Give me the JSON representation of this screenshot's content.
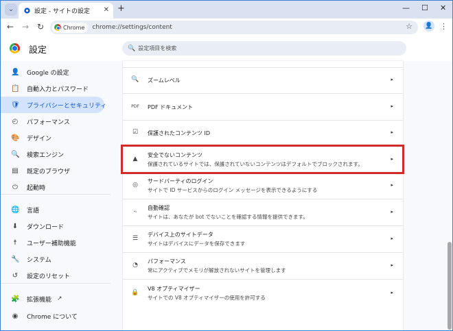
{
  "window": {
    "tab_title": "設定 - サイトの設定",
    "close_tab_glyph": "✕",
    "new_tab_glyph": "+",
    "minimize_glyph": "—",
    "maximize_glyph": "☐",
    "close_glyph": "✕"
  },
  "toolbar": {
    "chip_label": "Chrome",
    "url": "chrome://settings/content"
  },
  "header": {
    "title": "設定",
    "search_placeholder": "設定項目を検索"
  },
  "sidebar": {
    "items": [
      {
        "icon": "person-icon",
        "glyph": "👤",
        "label": "Google の設定"
      },
      {
        "icon": "clipboard-icon",
        "glyph": "📋",
        "label": "自動入力とパスワード"
      },
      {
        "icon": "shield-icon",
        "glyph": "🛡",
        "label": "プライバシーとセキュリティ"
      },
      {
        "icon": "gauge-icon",
        "glyph": "◴",
        "label": "パフォーマンス"
      },
      {
        "icon": "palette-icon",
        "glyph": "🎨",
        "label": "デザイン"
      },
      {
        "icon": "search-icon",
        "glyph": "🔍",
        "label": "検索エンジン"
      },
      {
        "icon": "browser-icon",
        "glyph": "▤",
        "label": "既定のブラウザ"
      },
      {
        "icon": "power-icon",
        "glyph": "⏻",
        "label": "起動時"
      },
      {
        "icon": "globe-icon",
        "glyph": "🌐",
        "label": "言語"
      },
      {
        "icon": "download-icon",
        "glyph": "⬇",
        "label": "ダウンロード"
      },
      {
        "icon": "accessibility-icon",
        "glyph": "☨",
        "label": "ユーザー補助機能"
      },
      {
        "icon": "wrench-icon",
        "glyph": "🔧",
        "label": "システム"
      },
      {
        "icon": "history-icon",
        "glyph": "↺",
        "label": "設定のリセット"
      },
      {
        "icon": "puzzle-icon",
        "glyph": "🧩",
        "label": "拡張機能"
      },
      {
        "icon": "chrome-icon",
        "glyph": "◉",
        "label": "Chrome について"
      }
    ],
    "active_index": 2
  },
  "content": {
    "rows": [
      {
        "icon": "magnifier-icon",
        "glyph": "🔍",
        "title": "ズームレベル",
        "sub": ""
      },
      {
        "icon": "pdf-icon",
        "glyph": "PDF",
        "title": "PDF ドキュメント",
        "sub": ""
      },
      {
        "icon": "protected-content-icon",
        "glyph": "☑",
        "title": "保護されたコンテンツ ID",
        "sub": ""
      },
      {
        "icon": "warning-icon",
        "glyph": "▲",
        "title": "安全でないコンテンツ",
        "sub": "保護されているサイトでは、保護されていないコンテンツはデフォルトでブロックされます。"
      },
      {
        "icon": "third-party-signin-icon",
        "glyph": "◎",
        "title": "サードパーティのログイン",
        "sub": "サイトで ID サービスからのログイン メッセージを表示できるようにする"
      },
      {
        "icon": "auto-verify-icon",
        "glyph": "⍨",
        "title": "自動確認",
        "sub": "サイトは、あなたが bot でないことを確認する情報を提供できます。"
      },
      {
        "icon": "database-icon",
        "glyph": "☰",
        "title": "デバイス上のサイトデータ",
        "sub": "サイトはデバイスにデータを保存できます"
      },
      {
        "icon": "performance-icon",
        "glyph": "◔",
        "title": "パフォーマンス",
        "sub": "常にアクティブでメモリが解放されないサイトを管理します"
      },
      {
        "icon": "lock-icon",
        "glyph": "🔒",
        "title": "V8 オプティマイザー",
        "sub": "サイトでの V8 オプティマイザーの使用を許可する"
      }
    ],
    "arrow_glyph": "▸"
  },
  "colors": {
    "accent": "#0b57d0",
    "active_bg": "#d3e3fd",
    "highlight_border": "#d22a2a"
  }
}
